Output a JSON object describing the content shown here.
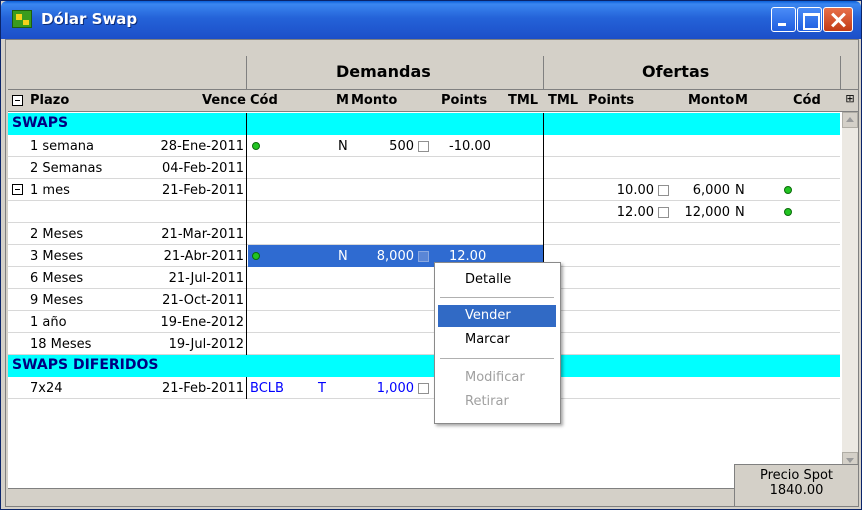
{
  "window": {
    "title": "Dólar Swap"
  },
  "groups": {
    "demandas": "Demandas",
    "ofertas": "Ofertas"
  },
  "columns": {
    "plazo": "Plazo",
    "vence": "Vence",
    "cod": "Cód",
    "m": "M",
    "monto": "Monto",
    "points": "Points",
    "tml": "TML",
    "tml2": "TML",
    "points2": "Points",
    "monto2": "Monto",
    "m2": "M",
    "cod2": "Cód"
  },
  "sections": {
    "swaps": "SWAPS",
    "diferidos": "SWAPS DIFERIDOS"
  },
  "rows": [
    {
      "plazo": "1 semana",
      "vence": "28-Ene-2011",
      "m": "N",
      "monto": "500",
      "points": "-10.00"
    },
    {
      "plazo": "2 Semanas",
      "vence": "04-Feb-2011"
    },
    {
      "plazo": "1 mes",
      "vence": "21-Feb-2011",
      "points2": "10.00",
      "monto2": "6,000",
      "m2": "N"
    },
    {
      "points2": "12.00",
      "monto2": "12,000",
      "m2": "N"
    },
    {
      "plazo": "2 Meses",
      "vence": "21-Mar-2011"
    },
    {
      "plazo": "3 Meses",
      "vence": "21-Abr-2011",
      "m": "N",
      "monto": "8,000",
      "points": "12.00"
    },
    {
      "plazo": "6 Meses",
      "vence": "21-Jul-2011"
    },
    {
      "plazo": "9 Meses",
      "vence": "21-Oct-2011"
    },
    {
      "plazo": "1 año",
      "vence": "19-Ene-2012"
    },
    {
      "plazo": "18 Meses",
      "vence": "19-Jul-2012"
    }
  ],
  "diferidos": [
    {
      "plazo": "7x24",
      "vence": "21-Feb-2011",
      "cod": "BCLB",
      "m": "T",
      "monto": "1,000"
    }
  ],
  "menu": {
    "detalle": "Detalle",
    "vender": "Vender",
    "marcar": "Marcar",
    "modificar": "Modificar",
    "retirar": "Retirar"
  },
  "status": {
    "precio_label": "Precio Spot",
    "precio_value": "1840.00"
  },
  "icons": {
    "app": "app-icon",
    "minimize": "minimize-icon",
    "maximize": "maximize-icon",
    "close": "close-icon",
    "status_dot": "green-dot-icon",
    "export": "excel-icon"
  }
}
